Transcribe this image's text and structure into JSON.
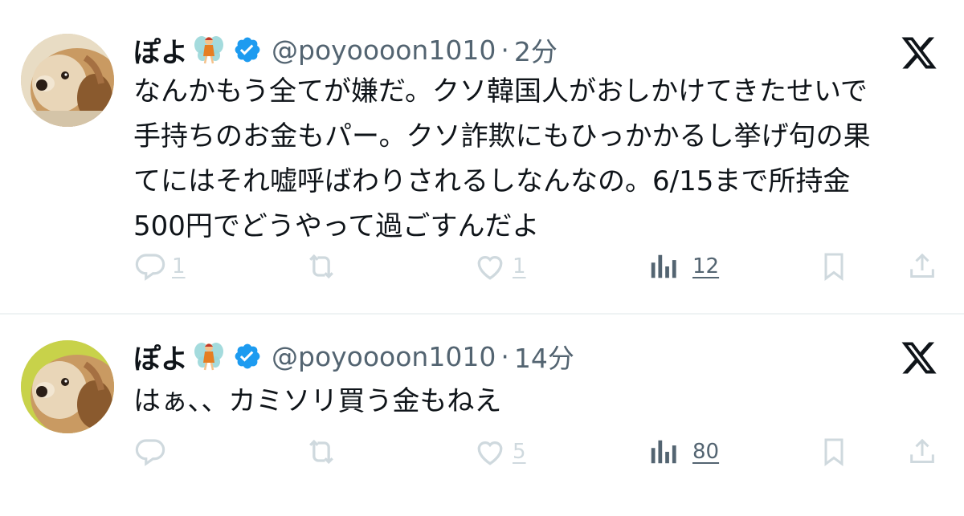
{
  "colors": {
    "text": "#0f1419",
    "secondary": "#536471",
    "faint_icon": "#cfd9de",
    "verified": "#1d9bf0",
    "divider": "#eff3f4"
  },
  "tweets": [
    {
      "display_name": "ぽよ",
      "name_emoji": "fairy",
      "verified_icon": "verified-badge",
      "handle": "@poyoooon1010",
      "separator": "·",
      "time": "2分",
      "text_lines": [
        "なんかもう全てが嫌だ。クソ韓国人がおしかけてきたせいで",
        "手持ちのお金もパー。クソ詐欺にもひっかかるし挙げ句の果",
        "てにはそれ嘘呼ばわりされるしなんなの。6/15まで所持金",
        "500円でどうやって過ごすんだよ"
      ],
      "stats": {
        "replies": "1",
        "reposts": "",
        "likes": "1",
        "views": "12"
      },
      "icons": [
        "reply-icon",
        "repost-icon",
        "like-icon",
        "views-icon",
        "bookmark-icon",
        "share-icon"
      ]
    },
    {
      "display_name": "ぽよ",
      "name_emoji": "fairy",
      "verified_icon": "verified-badge",
      "handle": "@poyoooon1010",
      "separator": "·",
      "time": "14分",
      "text_lines": [
        "はぁ、、カミソリ買う金もねえ"
      ],
      "stats": {
        "replies": "",
        "reposts": "",
        "likes": "5",
        "views": "80"
      },
      "icons": [
        "reply-icon",
        "repost-icon",
        "like-icon",
        "views-icon",
        "bookmark-icon",
        "share-icon"
      ]
    }
  ]
}
